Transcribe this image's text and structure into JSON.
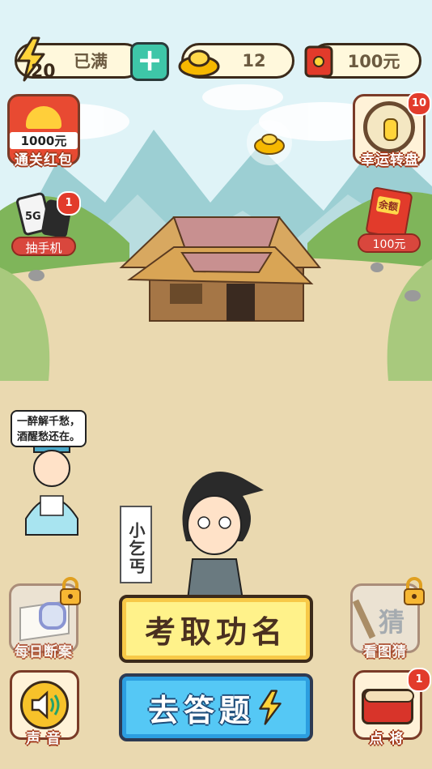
{
  "top_bar": {
    "energy_count": "20",
    "energy_status": "已满",
    "ingot_count": "12",
    "cash_amount": "100元"
  },
  "left_buttons": {
    "red_packet": {
      "amount": "1000元",
      "label": "通关红包"
    },
    "phone_draw": {
      "tag": "5G",
      "badge": "1",
      "label": "抽手机"
    },
    "daily_case": {
      "label": "每日断案"
    },
    "sound": {
      "label": "声 音"
    }
  },
  "right_buttons": {
    "lucky_wheel": {
      "badge": "10",
      "label": "幸运转盘"
    },
    "balance": {
      "tag": "余额",
      "amount": "100元"
    },
    "guess_picture": {
      "glyph": "猜",
      "label": "看图猜"
    },
    "summon": {
      "badge": "1",
      "label": "点 将"
    }
  },
  "dialog": {
    "speech": "一醉解千愁，酒醒愁还在。",
    "speech_line1": "一醉解千愁，",
    "speech_line2": "酒醒愁还在。",
    "character_name": "小乞丐"
  },
  "actions": {
    "exam": "考取功名",
    "answer": "去答题"
  },
  "colors": {
    "accent_teal": "#3ec6a8",
    "exam_yellow": "#fff28a",
    "answer_blue": "#55c8f5",
    "badge_red": "#e23b2b"
  },
  "icons": [
    "lightning-icon",
    "plus-icon",
    "gold-ingot-icon",
    "red-packet-icon",
    "lucky-wheel-icon",
    "phone-icon",
    "lock-icon",
    "magnifier-icon",
    "speaker-icon",
    "drum-icon",
    "brush-icon"
  ]
}
